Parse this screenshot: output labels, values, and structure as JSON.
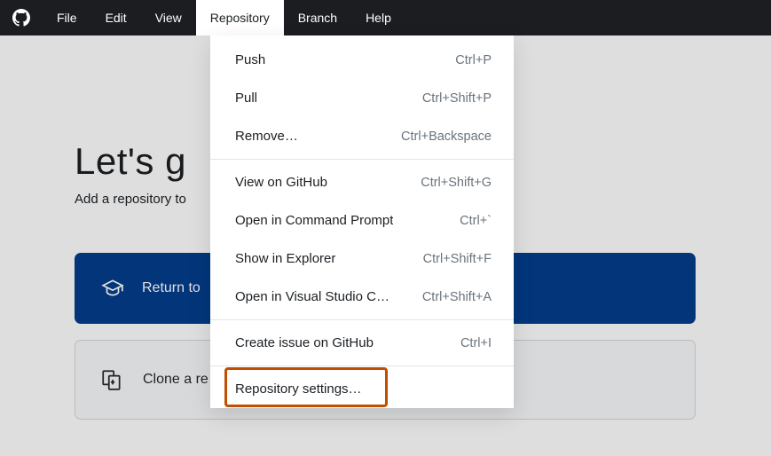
{
  "menubar": {
    "items": [
      {
        "label": "File"
      },
      {
        "label": "Edit"
      },
      {
        "label": "View"
      },
      {
        "label": "Repository",
        "active": true
      },
      {
        "label": "Branch"
      },
      {
        "label": "Help"
      }
    ]
  },
  "page": {
    "title": "Let's g",
    "subtitle": "Add a repository to"
  },
  "buttons": {
    "primary_label": "Return to",
    "secondary_label": "Clone a re"
  },
  "dropdown": {
    "groups": [
      [
        {
          "label": "Push",
          "shortcut": "Ctrl+P"
        },
        {
          "label": "Pull",
          "shortcut": "Ctrl+Shift+P"
        },
        {
          "label": "Remove…",
          "shortcut": "Ctrl+Backspace"
        }
      ],
      [
        {
          "label": "View on GitHub",
          "shortcut": "Ctrl+Shift+G"
        },
        {
          "label": "Open in Command Prompt",
          "shortcut": "Ctrl+`"
        },
        {
          "label": "Show in Explorer",
          "shortcut": "Ctrl+Shift+F"
        },
        {
          "label": "Open in Visual Studio C…",
          "shortcut": "Ctrl+Shift+A"
        }
      ],
      [
        {
          "label": "Create issue on GitHub",
          "shortcut": "Ctrl+I"
        }
      ],
      [
        {
          "label": "Repository settings…",
          "shortcut": "",
          "highlighted": true
        }
      ]
    ]
  }
}
